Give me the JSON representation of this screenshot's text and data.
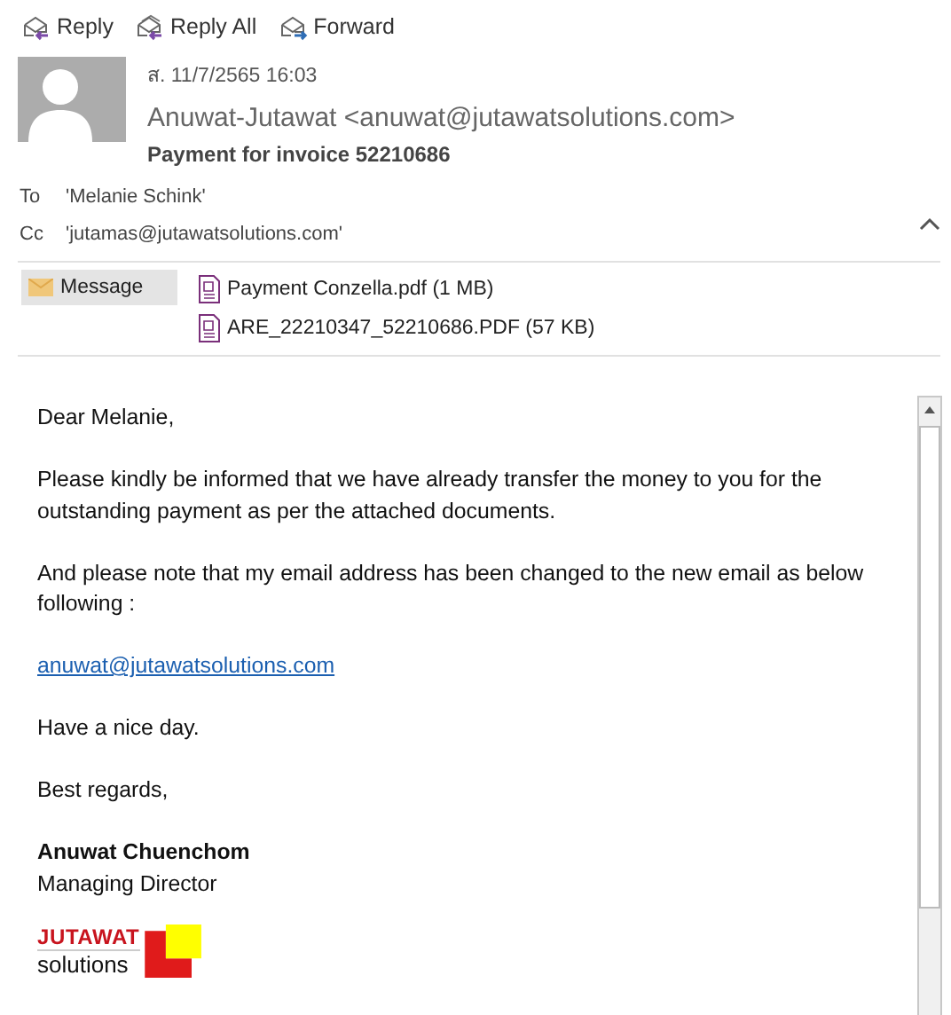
{
  "toolbar": [
    {
      "label": "Reply",
      "kind": "reply"
    },
    {
      "label": "Reply All",
      "kind": "reply-all"
    },
    {
      "label": "Forward",
      "kind": "forward"
    }
  ],
  "header": {
    "date": "ส. 11/7/2565 16:03",
    "from": "Anuwat-Jutawat <anuwat@jutawatsolutions.com>",
    "subject": "Payment for invoice 52210686",
    "expanded": true,
    "recipients": [
      {
        "label": "To",
        "value": "'Melanie Schink'"
      },
      {
        "label": "Cc",
        "value": "'jutamas@jutawatsolutions.com'"
      }
    ]
  },
  "attachments": [
    {
      "label": "Message",
      "kind": "message",
      "selected": true
    },
    {
      "label": "Payment Conzella.pdf (1 MB)",
      "kind": "pdf",
      "selected": false
    },
    {
      "label": "ARE_22210347_52210686.PDF (57 KB)",
      "kind": "pdf",
      "selected": false
    }
  ],
  "body": [
    {
      "kind": "text",
      "text": "Dear Melanie,"
    },
    {
      "kind": "text",
      "text": "Please kindly be informed that we have already transfer the money to you for the outstanding payment as per the attached documents."
    },
    {
      "kind": "text",
      "text": "And please note that my email address has been changed to the new email as below following :"
    },
    {
      "kind": "link",
      "text": "anuwat@jutawatsolutions.com"
    },
    {
      "kind": "text",
      "text": "Have a nice day."
    },
    {
      "kind": "text",
      "text": "Best regards,"
    },
    {
      "kind": "name",
      "text": "Anuwat Chuenchom"
    },
    {
      "kind": "title",
      "text": "Managing Director"
    }
  ],
  "logo": {
    "top": "JUTAWAT",
    "bottom": "solutions"
  }
}
